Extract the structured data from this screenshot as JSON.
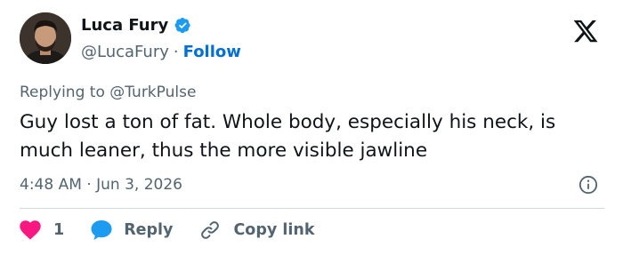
{
  "author": {
    "name": "Luca Fury",
    "handle": "@LucaFury",
    "separator": "·",
    "follow_label": "Follow"
  },
  "tweet": {
    "replying_to": "Replying to @TurkPulse",
    "text": "Guy lost a ton of fat. Whole body, especially his neck, is much leaner, thus the more visible jawline",
    "time": "4:48 AM",
    "meta_separator": "·",
    "date": "Jun 3, 2026"
  },
  "actions": {
    "like_count": "1",
    "reply_label": "Reply",
    "copy_link_label": "Copy link"
  },
  "colors": {
    "like": "#f91880",
    "reply": "#1d9bf0",
    "follow": "#006fd6",
    "verified": "#1d9bf0",
    "secondary_text": "#536471"
  },
  "icons": {
    "verified": "verified-badge-icon",
    "logo": "x-logo-icon",
    "info": "info-icon",
    "like": "heart-icon",
    "reply": "speech-bubble-icon",
    "copy": "link-icon"
  }
}
